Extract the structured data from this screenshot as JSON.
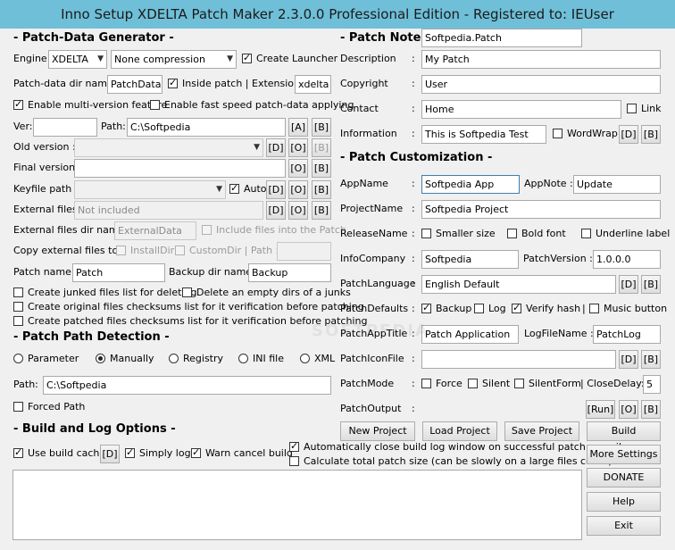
{
  "window": {
    "title": "Inno Setup XDELTA Patch Maker 2.3.0.0 Professional Edition - Registered to: IEUser"
  },
  "generator": {
    "section_title": "- Patch-Data Generator -",
    "engine_label": "Engine:",
    "engine_value": "XDELTA",
    "compression_value": "None compression",
    "create_launcher": "Create Launcher",
    "datadir_label": "Patch-data dir name:",
    "datadir_value": "PatchData",
    "inside_patch": "Inside patch | Extension:",
    "extension_value": "xdelta",
    "multiversion": "Enable multi-version feature",
    "fastspeed": "Enable fast speed patch-data applying",
    "ver_label": "Ver:",
    "path_label": "Path:",
    "path_value": "C:\\Softpedia",
    "btn_a": "[A]",
    "btn_b": "[B]",
    "old_version": "Old version :",
    "btn_d": "[D]",
    "btn_o": "[O]",
    "final_version": "Final version:",
    "keyfile_path": "Keyfile path :",
    "auto": "Auto",
    "external_files": "External files:",
    "external_placeholder": "Not included",
    "external_dir": "External files dir name:",
    "external_dir_value": "ExternalData",
    "include_files": "Include files into the Patch",
    "copy_external": "Copy external files to :",
    "install_dir": "InstallDir",
    "custom_dir": "CustomDir | Path :",
    "patch_name_label": "Patch name :",
    "patch_name_value": "Patch",
    "backup_dir_label": "Backup dir name :",
    "backup_dir_value": "Backup",
    "junked": "Create junked files list for deleting",
    "delete_empty": "Delete an empty dirs of a junks",
    "orig_checksums": "Create original files checksums list for it verification before patching",
    "patched_checksums": "Create patched files checksums list for it verification before patching"
  },
  "detection": {
    "section_title": "- Patch Path Detection -",
    "parameter": "Parameter",
    "manually": "Manually",
    "registry": "Registry",
    "ini_file": "INI file",
    "xml": "XML",
    "path_label": "Path:",
    "path_value": "C:\\Softpedia",
    "forced_path": "Forced Path"
  },
  "build": {
    "section_title": "- Build and Log Options -",
    "use_cache": "Use build cache",
    "btn_d": "[D]",
    "simply_log": "Simply log",
    "warn_cancel": "Warn cancel build",
    "auto_close": "Automatically close build log window on successful patch compile",
    "calc_size": "Calculate total patch size (can be slowly on a large files count)"
  },
  "notes": {
    "section_title": "- Patch Notes -",
    "description_label": "Description",
    "description_value": "My Patch",
    "copyright_label": "Copyright",
    "copyright_value": "User",
    "contact_label": "Contact",
    "contact_value": "Home",
    "link": "Link",
    "information_label": "Information",
    "information_value": "This is  Softpedia Test",
    "wordwrap": "WordWrap",
    "btn_d": "[D]",
    "btn_b": "[B]",
    "colon": ":"
  },
  "custom": {
    "section_title": "- Patch Customization -",
    "appname_label": "AppName",
    "appname_value": "Softpedia App",
    "appnote_label": "AppNote :",
    "appnote_value": "Update",
    "projectname_label": "ProjectName",
    "projectname_value": "Softpedia Project",
    "releasename_label": "ReleaseName",
    "smaller_size": "Smaller size",
    "bold_font": "Bold font",
    "underline_label": "Underline label",
    "infocompany_label": "InfoCompany",
    "infocompany_value": "Softpedia",
    "patchversion_label": "PatchVersion :",
    "patchversion_value": "1.0.0.0",
    "patchlanguage_label": "PatchLanguage",
    "patchlanguage_value": "English Default",
    "patchdefaults_label": "PatchDefaults",
    "backup": "Backup",
    "log": "Log",
    "verify_hash": "Verify hash",
    "pipe": "|",
    "music_button": "Music button",
    "patchapptitle_label": "PatchAppTitle",
    "patchapptitle_value": "Patch Application",
    "logfilename_label": "LogFileName :",
    "logfilename_value": "PatchLog",
    "patchiconfile_label": "PatchIconFile",
    "patchmode_label": "PatchMode",
    "force": "Force",
    "silent": "Silent",
    "silentform": "SilentForm",
    "closedelay": "| CloseDelay:",
    "closedelay_value": "5",
    "patchoutput_label": "PatchOutput",
    "patchoutput_value": "Softpedia.Patch",
    "run": "[Run]",
    "btn_d": "[D]",
    "btn_o": "[O]",
    "btn_b": "[B]",
    "colon": ":"
  },
  "actions": {
    "new_project": "New Project",
    "load_project": "Load Project",
    "save_project": "Save Project",
    "build": "Build",
    "more_settings": "More Settings",
    "donate": "DONATE",
    "help": "Help",
    "exit": "Exit"
  },
  "watermark": "SOFTPEDIA"
}
